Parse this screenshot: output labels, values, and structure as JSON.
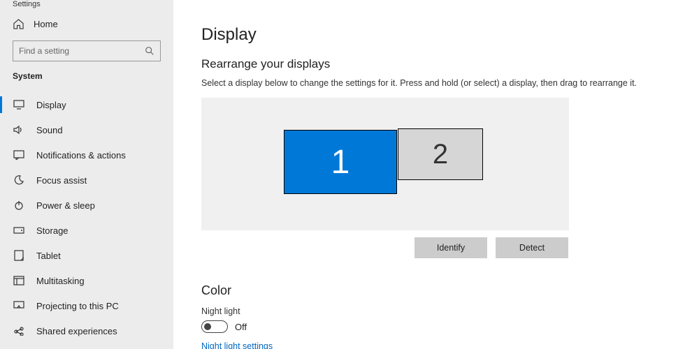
{
  "app_title": "Settings",
  "home_label": "Home",
  "search_placeholder": "Find a setting",
  "category_label": "System",
  "nav": [
    {
      "label": "Display"
    },
    {
      "label": "Sound"
    },
    {
      "label": "Notifications & actions"
    },
    {
      "label": "Focus assist"
    },
    {
      "label": "Power & sleep"
    },
    {
      "label": "Storage"
    },
    {
      "label": "Tablet"
    },
    {
      "label": "Multitasking"
    },
    {
      "label": "Projecting to this PC"
    },
    {
      "label": "Shared experiences"
    }
  ],
  "main": {
    "title": "Display",
    "rearrange_heading": "Rearrange your displays",
    "rearrange_desc": "Select a display below to change the settings for it. Press and hold (or select) a display, then drag to rearrange it.",
    "monitor1": "1",
    "monitor2": "2",
    "identify_label": "Identify",
    "detect_label": "Detect",
    "color_heading": "Color",
    "night_light_label": "Night light",
    "night_light_state": "Off",
    "night_light_link": "Night light settings"
  }
}
